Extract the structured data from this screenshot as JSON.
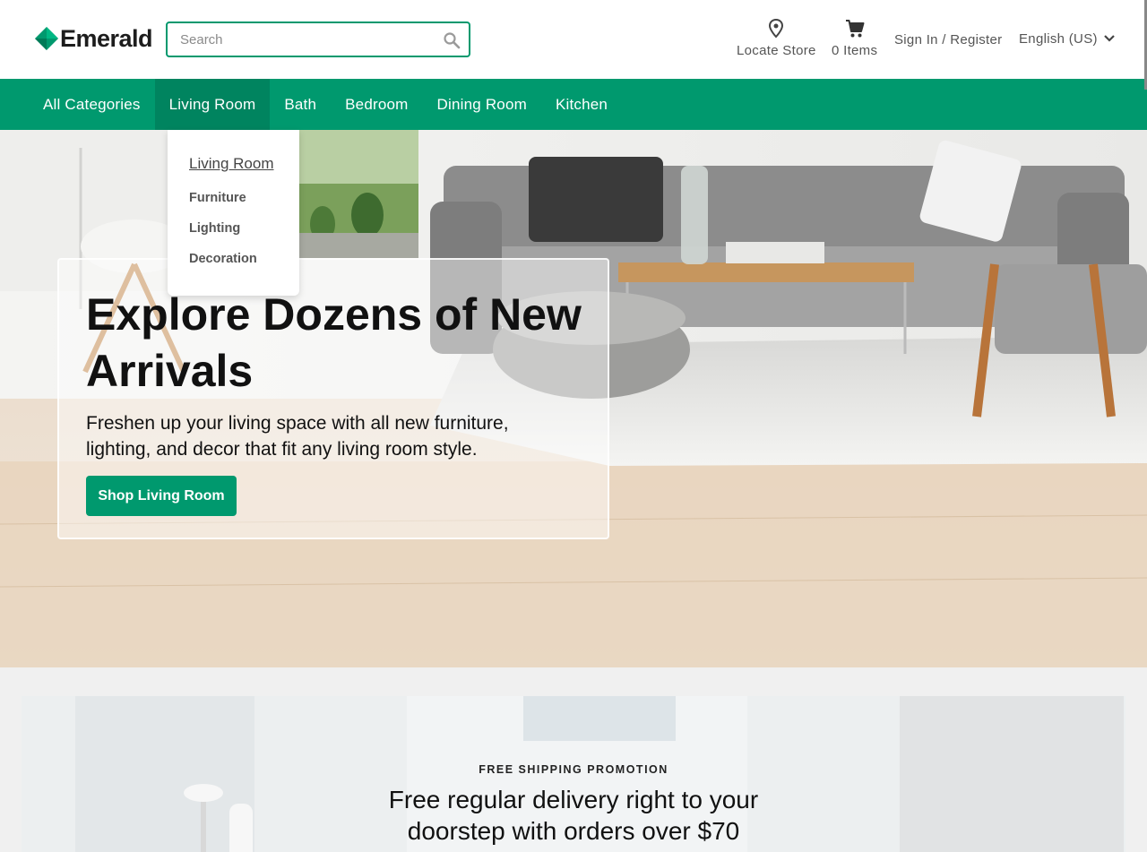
{
  "brand": {
    "name": "Emerald",
    "accent": "#00996e"
  },
  "search": {
    "placeholder": "Search",
    "value": ""
  },
  "header": {
    "locate_label": "Locate Store",
    "cart_label": "0 Items",
    "signin_label": "Sign In / Register",
    "language_label": "English (US)"
  },
  "nav": {
    "items": [
      {
        "label": "All Categories"
      },
      {
        "label": "Living Room"
      },
      {
        "label": "Bath"
      },
      {
        "label": "Bedroom"
      },
      {
        "label": "Dining Room"
      },
      {
        "label": "Kitchen"
      }
    ],
    "active": "Living Room"
  },
  "dropdown": {
    "title": "Living Room",
    "items": [
      "Furniture",
      "Lighting",
      "Decoration"
    ]
  },
  "hero": {
    "title": "Explore Dozens of New Arrivals",
    "subtitle": "Freshen up your living space with all new furniture, lighting, and decor that fit any living room style.",
    "cta": "Shop Living Room"
  },
  "promo": {
    "eyebrow": "FREE SHIPPING PROMOTION",
    "title": "Free regular delivery right to your doorstep with orders over $70"
  },
  "icons": {
    "search": "search-icon",
    "location": "location-pin-icon",
    "cart": "shopping-cart-icon",
    "chevron": "chevron-down-icon"
  }
}
